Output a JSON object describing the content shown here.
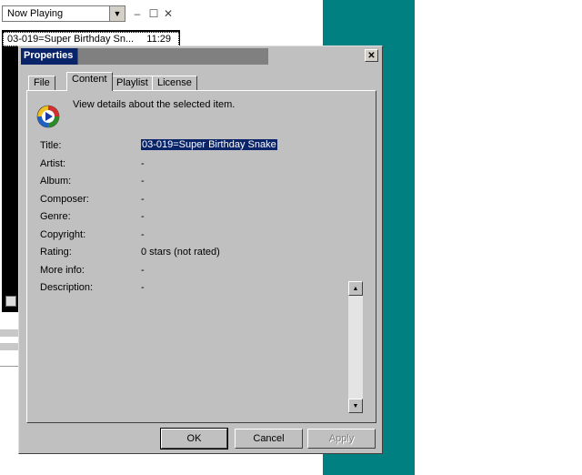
{
  "player": {
    "combo_value": "Now Playing",
    "playlist": [
      {
        "title": "03-019=Super Birthday Sn...",
        "duration": "11:29"
      }
    ]
  },
  "dialog": {
    "title": "Properties",
    "close_label": "✕",
    "tabs": [
      {
        "label": "File",
        "active": false
      },
      {
        "label": "Content",
        "active": true
      },
      {
        "label": "Playlist",
        "active": false
      },
      {
        "label": "License",
        "active": false
      }
    ],
    "description": "View details about the selected item.",
    "fields": [
      {
        "label": "Title:",
        "value": "03-019=Super Birthday Snake"
      },
      {
        "label": "Artist:",
        "value": "-"
      },
      {
        "label": "Album:",
        "value": "-"
      },
      {
        "label": "Composer:",
        "value": "-"
      },
      {
        "label": "Genre:",
        "value": "-"
      },
      {
        "label": "Copyright:",
        "value": "-"
      },
      {
        "label": "Rating:",
        "value": "0 stars (not rated)"
      },
      {
        "label": "More info:",
        "value": "-"
      },
      {
        "label": "Description:",
        "value": "-"
      }
    ],
    "buttons": {
      "ok": "OK",
      "cancel": "Cancel",
      "apply": "Apply"
    }
  },
  "colors": {
    "titlebar": "#0a246a",
    "face": "#c0c0c0",
    "desktop": "#008080"
  },
  "icons": {
    "media": "media-player-icon",
    "scroll_up": "scroll-up-icon",
    "scroll_down": "scroll-down-icon"
  }
}
